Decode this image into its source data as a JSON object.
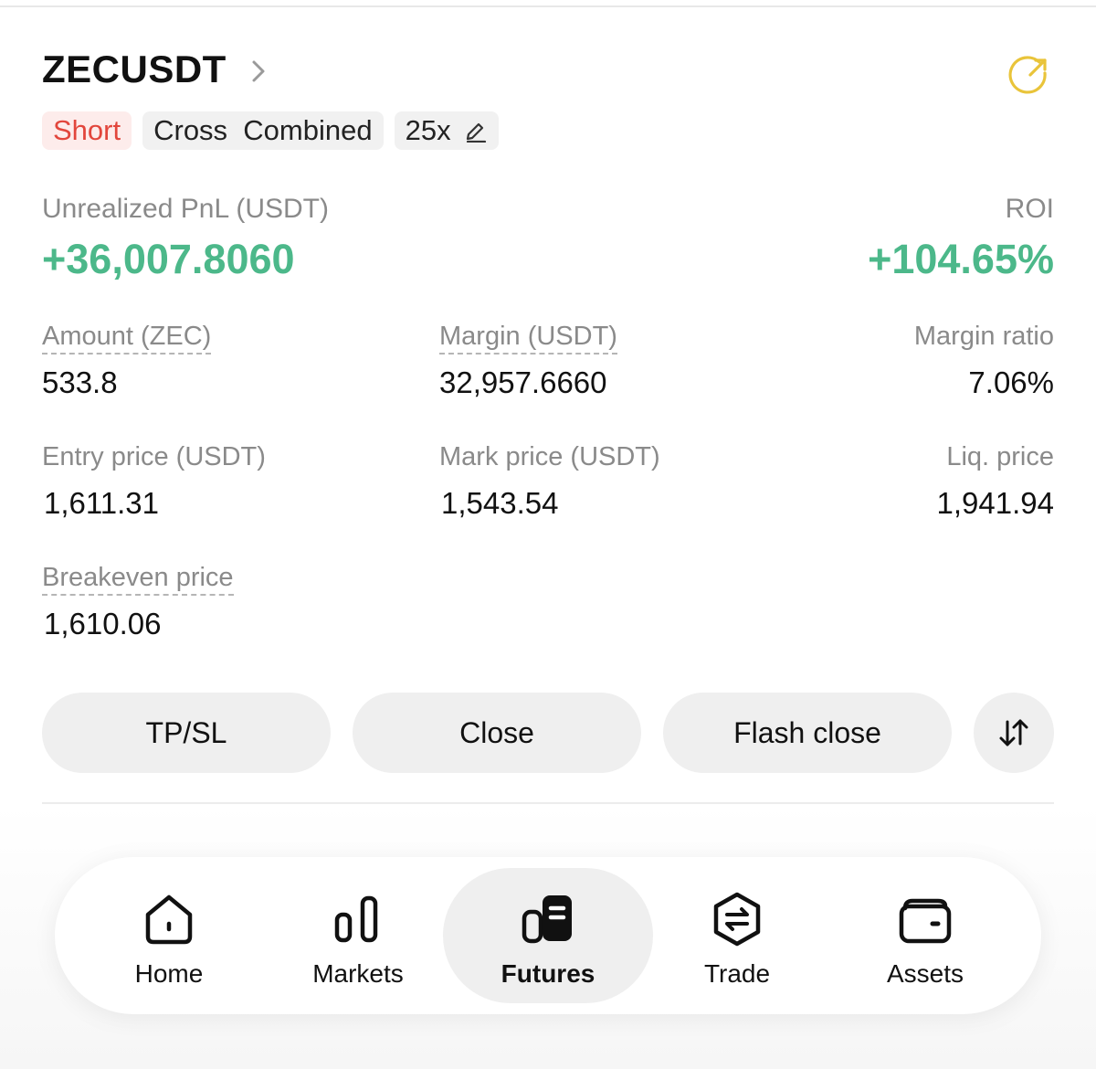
{
  "position": {
    "symbol": "ZECUSDT",
    "side_tag": "Short",
    "margin_mode_tag": "Cross  Combined",
    "leverage_tag": "25x",
    "pnl_label": "Unrealized PnL (USDT)",
    "pnl_value": "+36,007.8060",
    "roi_label": "ROI",
    "roi_value": "+104.65%",
    "fields": {
      "amount_label": "Amount (ZEC)",
      "amount_value": "533.8",
      "margin_label": "Margin (USDT)",
      "margin_value": "32,957.6660",
      "margin_ratio_label": "Margin ratio",
      "margin_ratio_value": "7.06%",
      "entry_label": "Entry price (USDT)",
      "entry_value": "1,611.31",
      "mark_label": "Mark price (USDT)",
      "mark_value": "1,543.54",
      "liq_label": "Liq. price",
      "liq_value": "1,941.94",
      "breakeven_label": "Breakeven price",
      "breakeven_value": "1,610.06"
    }
  },
  "actions": {
    "tpsl": "TP/SL",
    "close": "Close",
    "flash_close": "Flash close"
  },
  "tabs": [
    {
      "label": "Home",
      "icon": "home-icon"
    },
    {
      "label": "Markets",
      "icon": "markets-icon"
    },
    {
      "label": "Futures",
      "icon": "futures-icon",
      "active": true
    },
    {
      "label": "Trade",
      "icon": "trade-icon"
    },
    {
      "label": "Assets",
      "icon": "wallet-icon"
    }
  ],
  "colors": {
    "profit_green": "#4cb88a",
    "short_red": "#e2463c",
    "short_bg": "#fdeceb",
    "share_icon_yellow": "#e9c43a"
  }
}
